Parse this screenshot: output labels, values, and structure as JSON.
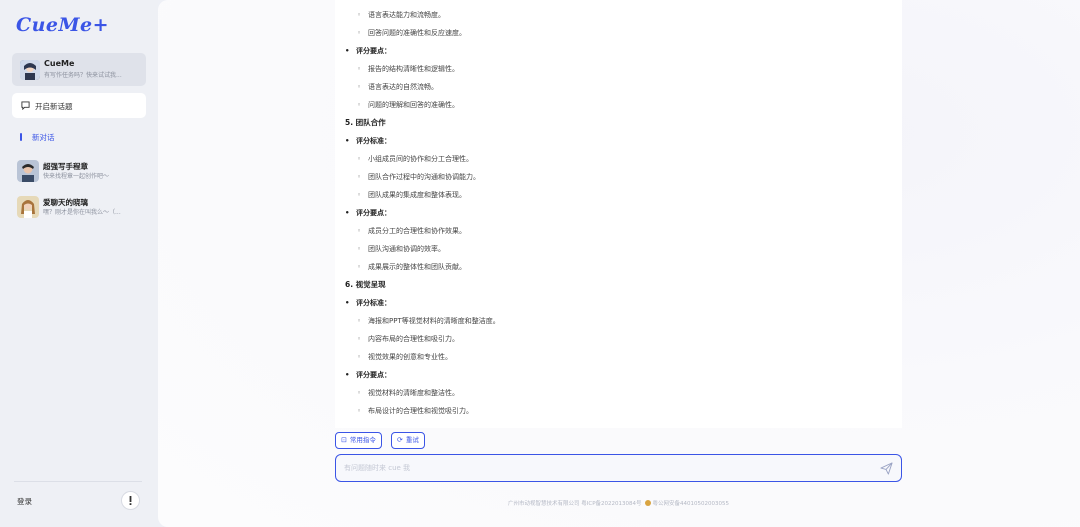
{
  "sidebar": {
    "logo": "CueMe+",
    "profile": {
      "name": "CueMe",
      "subtitle": "有写作任务吗？快来试试我..."
    },
    "new_topic_label": "开启新话题",
    "new_chat_label": "新对话",
    "chats": [
      {
        "title": "超强写手程章",
        "subtitle": "快来找程章一起创作吧～"
      },
      {
        "title": "爱聊天的晓璃",
        "subtitle": "嘿？刚才是你在叫我么～（..."
      }
    ],
    "login_label": "登录",
    "info_label": "!"
  },
  "content_lines": [
    {
      "type": "sub",
      "text": "语言表达能力和流畅度。"
    },
    {
      "type": "sub",
      "text": "回答问题的准确性和反应速度。"
    },
    {
      "type": "bullet",
      "text": "评分要点："
    },
    {
      "type": "sub",
      "text": "报告的结构清晰性和逻辑性。"
    },
    {
      "type": "sub",
      "text": "语言表达的自然流畅。"
    },
    {
      "type": "sub",
      "text": "问题的理解和回答的准确性。"
    },
    {
      "type": "heading",
      "text": "5. 团队合作"
    },
    {
      "type": "bullet",
      "text": "评分标准："
    },
    {
      "type": "sub",
      "text": "小组成员间的协作和分工合理性。"
    },
    {
      "type": "sub",
      "text": "团队合作过程中的沟通和协调能力。"
    },
    {
      "type": "sub",
      "text": "团队成果的集成度和整体表现。"
    },
    {
      "type": "bullet",
      "text": "评分要点："
    },
    {
      "type": "sub",
      "text": "成员分工的合理性和协作效果。"
    },
    {
      "type": "sub",
      "text": "团队沟通和协调的效率。"
    },
    {
      "type": "sub",
      "text": "成果展示的整体性和团队贡献。"
    },
    {
      "type": "heading",
      "text": "6. 视觉呈现"
    },
    {
      "type": "bullet",
      "text": "评分标准："
    },
    {
      "type": "sub",
      "text": "海报和PPT等视觉材料的清晰度和整洁度。"
    },
    {
      "type": "sub",
      "text": "内容布局的合理性和吸引力。"
    },
    {
      "type": "sub",
      "text": "视觉效果的创意和专业性。"
    },
    {
      "type": "bullet",
      "text": "评分要点："
    },
    {
      "type": "sub",
      "text": "视觉材料的清晰度和整洁性。"
    },
    {
      "type": "sub",
      "text": "布局设计的合理性和视觉吸引力。"
    }
  ],
  "actions": {
    "common_commands": "常用指令",
    "retry": "重试"
  },
  "input": {
    "placeholder": "有问题随时来 cue 我"
  },
  "footer": {
    "company": "广州市动视智慧技术有限公司 粤ICP备2022013084号",
    "police": "粤公网安备44010502003055"
  },
  "colors": {
    "accent": "#3b55e6",
    "sidebar_bg": "#eef0f5",
    "content_bg": "#ffffff"
  },
  "icons": {
    "new_topic": "chat-bubble-icon",
    "common_commands": "command-icon",
    "retry": "refresh-icon",
    "send": "send-icon",
    "info": "info-icon"
  }
}
